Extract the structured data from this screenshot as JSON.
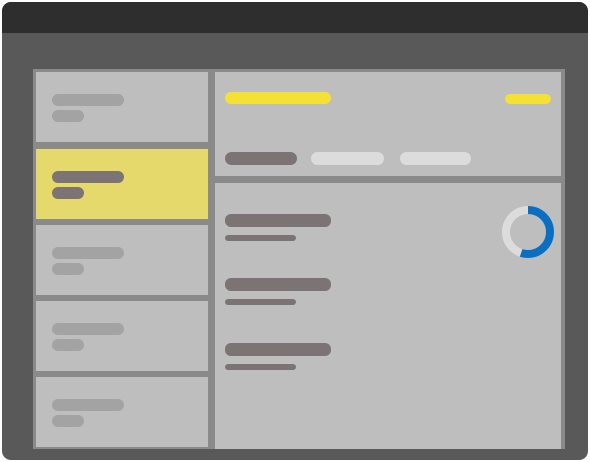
{
  "window": {
    "titlebar_color": "#2e2e2e",
    "body_color": "#595959"
  },
  "sidebar": {
    "items": [
      {
        "id": "item-1",
        "selected": false
      },
      {
        "id": "item-2",
        "selected": true
      },
      {
        "id": "item-3",
        "selected": false
      },
      {
        "id": "item-4",
        "selected": false
      },
      {
        "id": "item-5",
        "selected": false
      }
    ],
    "selected_color": "#e5d96c"
  },
  "header": {
    "accent_color": "#f5e036",
    "tabs": [
      {
        "id": "tab-1",
        "active": true
      },
      {
        "id": "tab-2",
        "active": false
      },
      {
        "id": "tab-3",
        "active": false
      }
    ]
  },
  "detail": {
    "rows": [
      {
        "id": "row-1"
      },
      {
        "id": "row-2"
      },
      {
        "id": "row-3"
      }
    ],
    "progress": {
      "value": 0.55,
      "track_color": "#dcdcdc",
      "fill_color": "#0a6fc2"
    }
  },
  "icons": {
    "progress": "progress-ring-icon"
  }
}
